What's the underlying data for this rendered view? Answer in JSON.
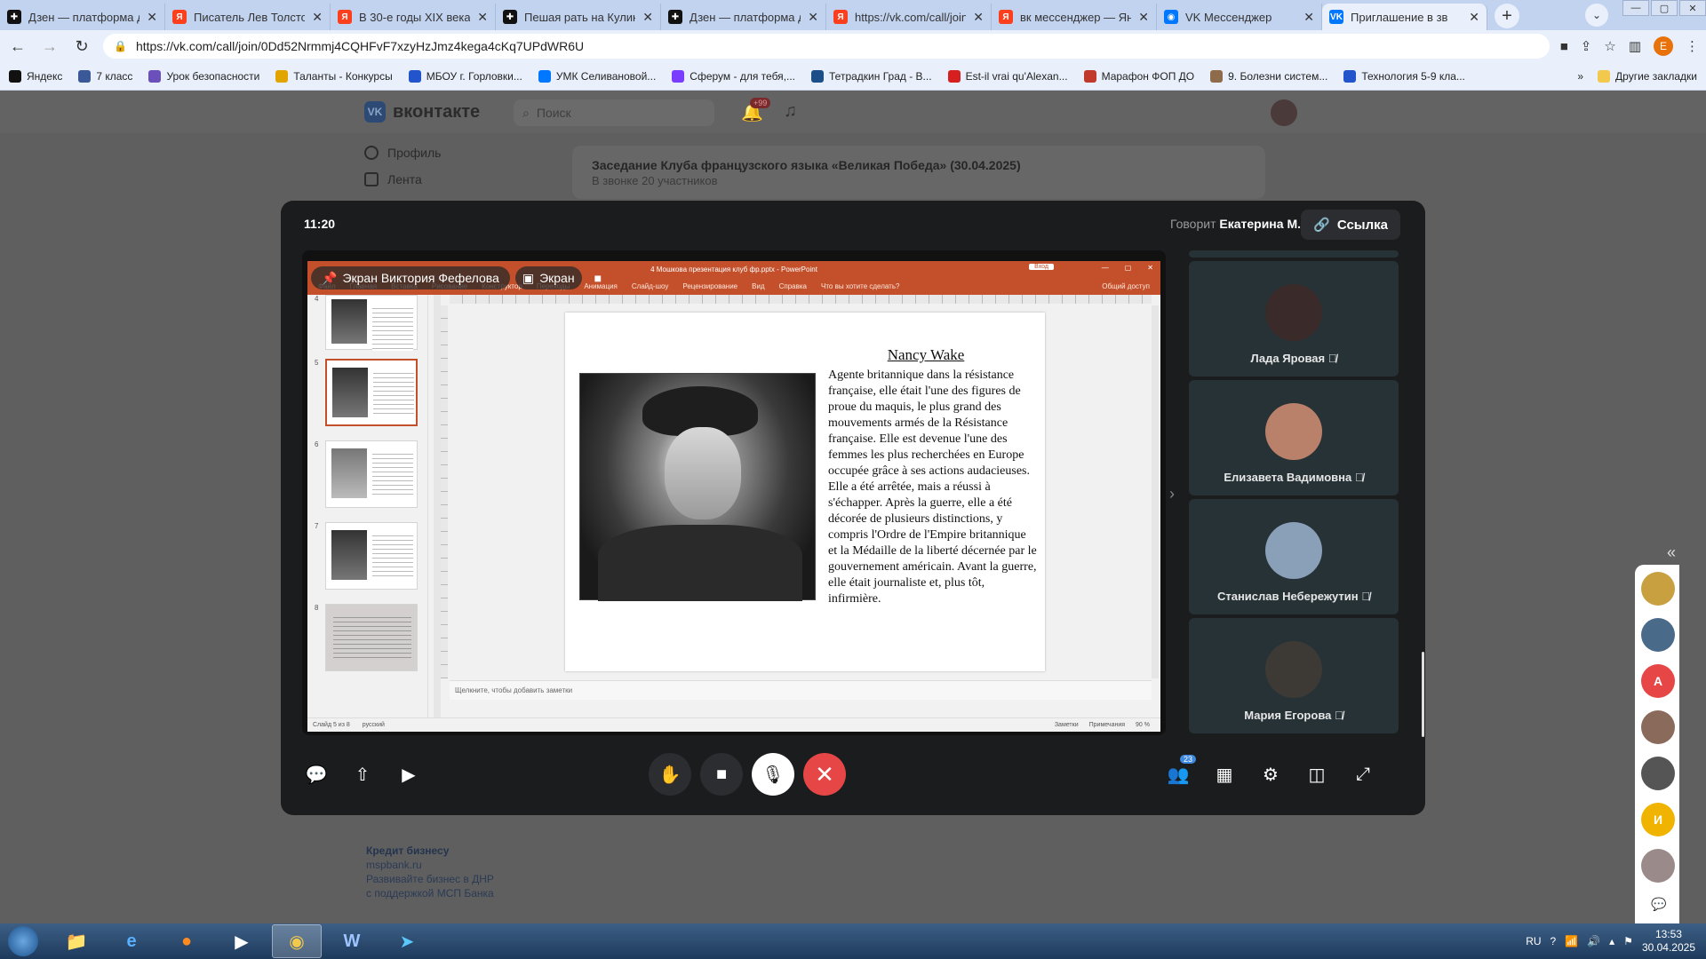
{
  "browser": {
    "tabs": [
      {
        "label": "Дзен — платформа д",
        "color": "#111111",
        "glyph": "✚"
      },
      {
        "label": "Писатель Лев Толстой",
        "color": "#fc3f1d",
        "glyph": "Я"
      },
      {
        "label": "В 30-е годы XIX века",
        "color": "#fc3f1d",
        "glyph": "Я"
      },
      {
        "label": "Пешая рать на Кулико",
        "color": "#111111",
        "glyph": "✚"
      },
      {
        "label": "Дзен — платформа д",
        "color": "#111111",
        "glyph": "✚"
      },
      {
        "label": "https://vk.com/call/join",
        "color": "#fc3f1d",
        "glyph": "Я"
      },
      {
        "label": "вк мессенджер — Янд",
        "color": "#fc3f1d",
        "glyph": "Я"
      },
      {
        "label": "VK Мессенджер",
        "color": "#0077ff",
        "glyph": "◉"
      },
      {
        "label": "Приглашение в зв",
        "color": "#0077ff",
        "glyph": "VK"
      }
    ],
    "url": "https://vk.com/call/join/0Dd52Nrmmj4CQHFvF7xzyHzJmz4kega4cKq7UPdWR6U",
    "bookmarks": [
      {
        "label": "Яндекс",
        "color": "#111111"
      },
      {
        "label": "7 класс",
        "color": "#3b5998"
      },
      {
        "label": "Урок безопасности",
        "color": "#6b4fbb"
      },
      {
        "label": "Таланты - Конкурсы",
        "color": "#e2a400"
      },
      {
        "label": "МБОУ г. Горловки...",
        "color": "#2255cc"
      },
      {
        "label": "УМК Селивановой...",
        "color": "#0077ff"
      },
      {
        "label": "Сферум - для тебя,...",
        "color": "#7a3cff"
      },
      {
        "label": "Тетрадкин Град - В...",
        "color": "#1a4f8a"
      },
      {
        "label": "Est-il vrai qu'Alexan...",
        "color": "#d62020"
      },
      {
        "label": "Марафон ФОП ДО",
        "color": "#c0392b"
      },
      {
        "label": "9. Болезни систем...",
        "color": "#8e6b4b"
      },
      {
        "label": "Технология 5-9 кла...",
        "color": "#2255cc"
      }
    ],
    "other_bookmarks": "Другие закладки"
  },
  "vk": {
    "logo": "вконтакте",
    "search_placeholder": "Поиск",
    "notif_badge": "+99",
    "sidebar": [
      "Профиль",
      "Лента"
    ],
    "call_card": {
      "title": "Заседание Клуба французского языка «Великая Победа» (30.04.2025)",
      "subtitle": "В звонке 20 участников"
    },
    "ad": {
      "title": "Кредит бизнесу",
      "domain": "mspbank.ru",
      "text": "Развивайте бизнес в ДНР с поддержкой МСП Банка"
    }
  },
  "call": {
    "time": "11:20",
    "speaking_prefix": "Говорит",
    "speaker": "Екатерина М.",
    "link_label": "Ссылка",
    "screen_tag": "Экран Виктория Фефелова",
    "screen_btn": "Экран",
    "participants_count": "23",
    "participants": [
      {
        "name": "Лада Яровая",
        "avatar": "#3a2a2a"
      },
      {
        "name": "Елизавета Вадимовна",
        "avatar": "#b9806a"
      },
      {
        "name": "Станислав Небережутин",
        "avatar": "#8aa0b8"
      },
      {
        "name": "Мария Егорова",
        "avatar": "#3d3a36"
      }
    ]
  },
  "ppt": {
    "window_title": "4 Мошкова презентация клуб фр.pptx  -  PowerPoint",
    "login": "Вход",
    "ribbon": [
      "Файл",
      "Главная",
      "Вставка",
      "Рисование",
      "Конструктор",
      "Переходы",
      "Анимация",
      "Слайд-шоу",
      "Рецензирование",
      "Вид",
      "Справка",
      "Что вы хотите сделать?"
    ],
    "share": "Общий доступ",
    "slide_numbers": [
      "4",
      "5",
      "6",
      "7",
      "8"
    ],
    "slide_title": "Nancy Wake",
    "slide_text": "Agente britannique dans la résistance française, elle était l'une des figures de proue du maquis, le plus grand des mouvements armés de la Résistance française. Elle est devenue l'une des femmes les plus recherchées en Europe occupée grâce à ses actions audacieuses. Elle a été arrêtée, mais a réussi à s'échapper. Après la guerre, elle a été décorée de plusieurs distinctions, y compris l'Ordre de l'Empire britannique et la Médaille de la liberté décernée par le gouvernement américain. Avant la guerre, elle était journaliste et, plus tôt, infirmière.",
    "notes_placeholder": "Щелкните, чтобы добавить заметки",
    "status_slide": "Слайд 5 из 8",
    "status_lang": "русский",
    "status_notes": "Заметки",
    "status_comments": "Примечания",
    "zoom": "90 %"
  },
  "side_contacts": [
    {
      "color": "#c8a040",
      "letter": ""
    },
    {
      "color": "#4a6a8a",
      "letter": ""
    },
    {
      "color": "#e64646",
      "letter": "А"
    },
    {
      "color": "#8a6a5a",
      "letter": ""
    },
    {
      "color": "#555555",
      "letter": ""
    },
    {
      "color": "#f0b400",
      "letter": "И"
    },
    {
      "color": "#9a8a8a",
      "letter": ""
    }
  ],
  "taskbar": {
    "lang": "RU",
    "time": "13:53",
    "date": "30.04.2025"
  }
}
